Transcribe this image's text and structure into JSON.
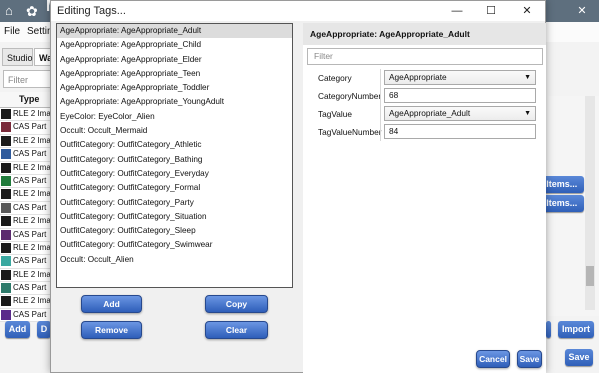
{
  "background": {
    "title": "Mo",
    "menu": [
      "File",
      "Settin"
    ],
    "tabs": [
      "Studio",
      "Wa"
    ],
    "filter_placeholder": "Filter",
    "table_header": "Type",
    "rows": [
      {
        "type": "RLE 2 Imag",
        "color": "#1a1a1a"
      },
      {
        "type": "CAS Part",
        "color": "#7a2a3a"
      },
      {
        "type": "RLE 2 Imag",
        "color": "#1a1a1a"
      },
      {
        "type": "CAS Part",
        "color": "#2e5a9c"
      },
      {
        "type": "RLE 2 Imag",
        "color": "#1a1a1a"
      },
      {
        "type": "CAS Part",
        "color": "#1f7a3a"
      },
      {
        "type": "RLE 2 Imag",
        "color": "#1a1a1a"
      },
      {
        "type": "CAS Part",
        "color": "#5a5a5a"
      },
      {
        "type": "RLE 2 Imag",
        "color": "#1a1a1a"
      },
      {
        "type": "CAS Part",
        "color": "#5b2a6e"
      },
      {
        "type": "RLE 2 Imag",
        "color": "#1a1a1a"
      },
      {
        "type": "CAS Part",
        "color": "#3aa8a0"
      },
      {
        "type": "RLE 2 Imag",
        "color": "#1a1a1a"
      },
      {
        "type": "CAS Part",
        "color": "#2d7a6a"
      },
      {
        "type": "RLE 2 Imag",
        "color": "#1a1a1a"
      },
      {
        "type": "CAS Part",
        "color": "#5a2a8a"
      }
    ],
    "add_label": "Add",
    "d_label": "D",
    "import_label": "Import",
    "save_label": "Save",
    "items_label_1": "t Items...",
    "items_label_2": "t Items..."
  },
  "dialog": {
    "title": "Editing Tags...",
    "tags": [
      "AgeAppropriate: AgeAppropriate_Adult",
      "AgeAppropriate: AgeAppropriate_Child",
      "AgeAppropriate: AgeAppropriate_Elder",
      "AgeAppropriate: AgeAppropriate_Teen",
      "AgeAppropriate: AgeAppropriate_Toddler",
      "AgeAppropriate: AgeAppropriate_YoungAdult",
      "EyeColor: EyeColor_Alien",
      "Occult: Occult_Mermaid",
      "OutfitCategory: OutfitCategory_Athletic",
      "OutfitCategory: OutfitCategory_Bathing",
      "OutfitCategory: OutfitCategory_Everyday",
      "OutfitCategory: OutfitCategory_Formal",
      "OutfitCategory: OutfitCategory_Party",
      "OutfitCategory: OutfitCategory_Situation",
      "OutfitCategory: OutfitCategory_Sleep",
      "OutfitCategory: OutfitCategory_Swimwear",
      "Occult: Occult_Alien"
    ],
    "selected_index": 0,
    "buttons": {
      "add": "Add",
      "copy": "Copy",
      "remove": "Remove",
      "clear": "Clear",
      "cancel": "Cancel",
      "save": "Save"
    },
    "detail": {
      "title": "AgeAppropriate: AgeAppropriate_Adult",
      "filter_placeholder": "Filter",
      "properties": [
        {
          "label": "Category",
          "value": "AgeAppropriate",
          "combo": true
        },
        {
          "label": "CategoryNumber",
          "value": "68",
          "combo": false
        },
        {
          "label": "TagValue",
          "value": "AgeAppropriate_Adult",
          "combo": true
        },
        {
          "label": "TagValueNumber",
          "value": "84",
          "combo": false
        }
      ]
    }
  }
}
